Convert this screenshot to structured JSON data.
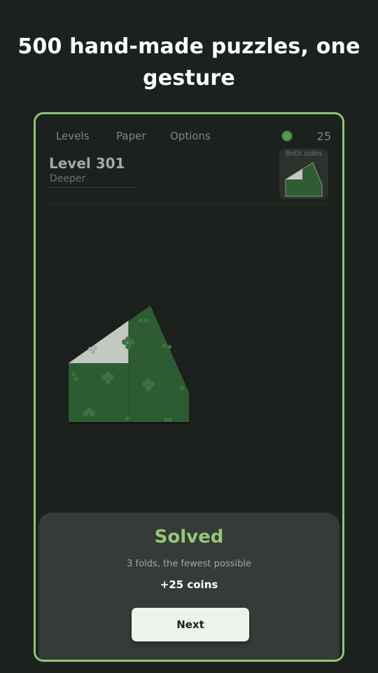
{
  "headline": "500 hand-made puzzles, one gesture",
  "nav": {
    "levels": "Levels",
    "paper": "Paper",
    "options": "Options"
  },
  "coins": {
    "count": "25",
    "icon": "coin-icon"
  },
  "level": {
    "title": "Level 301",
    "subtitle": "Deeper"
  },
  "target": {
    "label": "Both sides"
  },
  "result": {
    "title": "Solved",
    "description": "3 folds, the fewest possible",
    "reward": "+25 coins",
    "next_label": "Next"
  },
  "colors": {
    "background": "#1c211d",
    "accent": "#8fc47a",
    "paper_front": "#2e5c33",
    "paper_back": "#c4c8c3",
    "sheet": "#353b36",
    "button": "#eef2ec"
  }
}
